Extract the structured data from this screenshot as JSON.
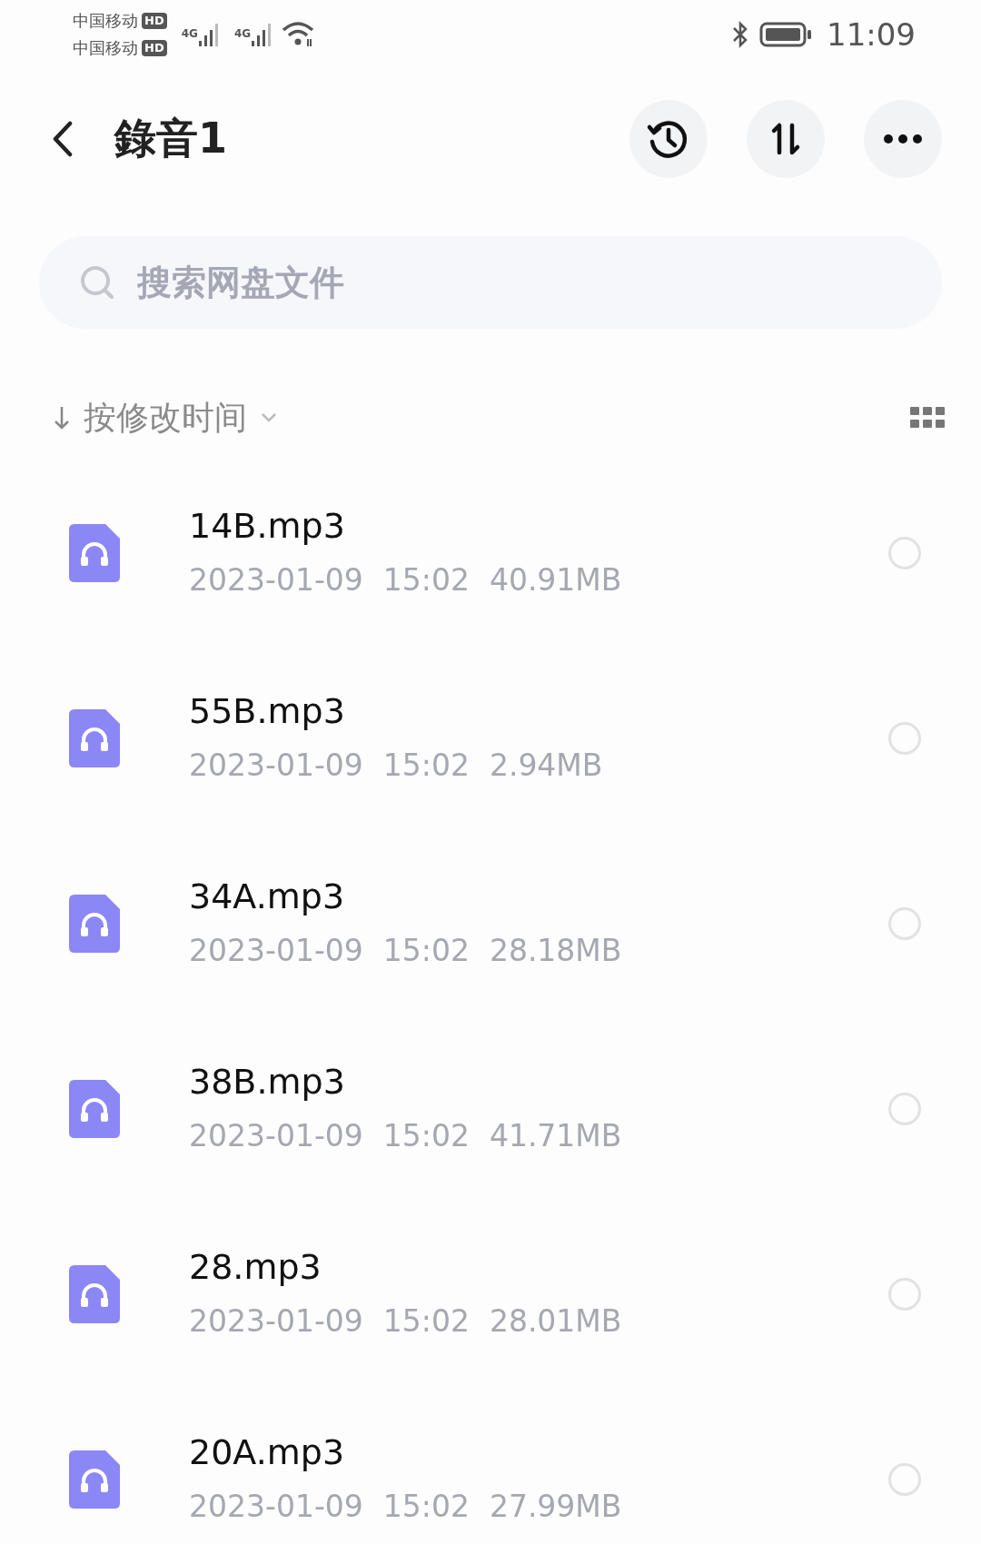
{
  "status_bar": {
    "carriers": [
      {
        "name": "中国移动",
        "badge": "HD"
      },
      {
        "name": "中国移动",
        "badge": "HD"
      }
    ],
    "networks": [
      "4G",
      "4G"
    ],
    "time": "11:09"
  },
  "header": {
    "title": "錄音1"
  },
  "search": {
    "placeholder": "搜索网盘文件"
  },
  "sort": {
    "label": "按修改时间"
  },
  "files": [
    {
      "name": "14B.mp3",
      "date": "2023-01-09",
      "time": "15:02",
      "size": "40.91MB",
      "selected": false
    },
    {
      "name": "55B.mp3",
      "date": "2023-01-09",
      "time": "15:02",
      "size": "2.94MB",
      "selected": false
    },
    {
      "name": "34A.mp3",
      "date": "2023-01-09",
      "time": "15:02",
      "size": "28.18MB",
      "selected": false
    },
    {
      "name": "38B.mp3",
      "date": "2023-01-09",
      "time": "15:02",
      "size": "41.71MB",
      "selected": false
    },
    {
      "name": "28.mp3",
      "date": "2023-01-09",
      "time": "15:02",
      "size": "28.01MB",
      "selected": false
    },
    {
      "name": "20A.mp3",
      "date": "2023-01-09",
      "time": "15:02",
      "size": "27.99MB",
      "selected": false
    }
  ]
}
